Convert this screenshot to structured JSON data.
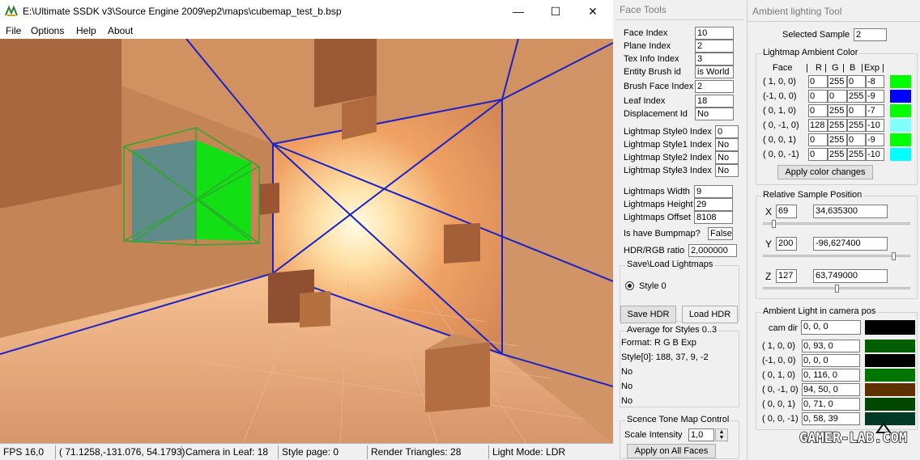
{
  "window": {
    "title": "E:\\Ultimate SSDK v3\\Source Engine 2009\\ep2\\maps\\cubemap_test_b.bsp",
    "minimize_glyph": "—",
    "maximize_glyph": "☐",
    "close_glyph": "✕"
  },
  "menu": [
    "File",
    "Options",
    "Help",
    "About"
  ],
  "status": {
    "fps": "FPS 16,0",
    "camera_pos": "( 71.1258,-131.076, 54.1793)",
    "camera_leaf": "Camera in Leaf: 18",
    "style_page": "Style page: 0",
    "render_triangles": "Render Triangles: 28",
    "light_mode": "Light Mode: LDR"
  },
  "face_tools": {
    "title": "Face Tools",
    "rows": [
      {
        "label": "Face Index",
        "value": "10"
      },
      {
        "label": "Plane Index",
        "value": "2"
      },
      {
        "label": "Tex Info Index",
        "value": "3"
      },
      {
        "label": "Entity Brush id",
        "value": "is World"
      },
      {
        "label": "Brush Face Index",
        "value": "2"
      },
      {
        "label": "Leaf Index",
        "value": "18"
      },
      {
        "label": "Displacement Id",
        "value": "No"
      }
    ],
    "styles": [
      {
        "label": "Lightmap Style0 Index",
        "value": "0"
      },
      {
        "label": "Lightmap Style1 Index",
        "value": "No"
      },
      {
        "label": "Lightmap Style2 Index",
        "value": "No"
      },
      {
        "label": "Lightmap Style3 Index",
        "value": "No"
      }
    ],
    "lightmap": [
      {
        "label": "Lightmaps Width",
        "value": "9"
      },
      {
        "label": "Lightmaps Height",
        "value": "29"
      },
      {
        "label": "Lightmaps Offset",
        "value": "8108"
      }
    ],
    "bumpmap_label": "Is have Bumpmap?",
    "bumpmap_value": "False",
    "hdr_ratio_label": "HDR/RGB ratio",
    "hdr_ratio_value": "2,000000",
    "save_load_title": "Save\\Load Lightmaps",
    "style_radio_label": "Style 0",
    "save_hdr": "Save HDR",
    "load_hdr": "Load HDR",
    "average_title": "Average for Styles 0..3",
    "average_lines": [
      "Format: R G B Exp",
      "Style[0]: 188,  37,  9,  -2",
      "No",
      "No",
      "No"
    ],
    "tonemap_title": "Scence Tone Map Control",
    "scale_label": "Scale Intensity",
    "scale_value": "1,0",
    "apply_all": "Apply on All Faces"
  },
  "ambient_tool": {
    "title": "Ambient lighting Tool",
    "selected_sample_label": "Selected Sample",
    "selected_sample_value": "2",
    "lightmap_color_title": "Lightmap Ambient Color",
    "header": {
      "face": "Face",
      "r": "R",
      "g": "G",
      "b": "B",
      "exp": "Exp"
    },
    "rows": [
      {
        "face": "( 1,  0,  0)",
        "r": "0",
        "g": "255",
        "b": "0",
        "exp": "-8",
        "color": "#00ff00"
      },
      {
        "face": "(-1,  0,  0)",
        "r": "0",
        "g": "0",
        "b": "255",
        "exp": "-9",
        "color": "#0000ff"
      },
      {
        "face": "( 0,  1,  0)",
        "r": "0",
        "g": "255",
        "b": "0",
        "exp": "-7",
        "color": "#00ff00"
      },
      {
        "face": "( 0, -1,  0)",
        "r": "128",
        "g": "255",
        "b": "255",
        "exp": "-10",
        "color": "#80ffff"
      },
      {
        "face": "( 0,  0,  1)",
        "r": "0",
        "g": "255",
        "b": "0",
        "exp": "-9",
        "color": "#00ff00"
      },
      {
        "face": "( 0,  0, -1)",
        "r": "0",
        "g": "255",
        "b": "255",
        "exp": "-10",
        "color": "#00ffff"
      }
    ],
    "apply_color": "Apply color changes",
    "rel_pos_title": "Relative Sample Position",
    "pos": [
      {
        "axis": "X",
        "index": "69",
        "value": "34,635300",
        "slider": 0.06
      },
      {
        "axis": "Y",
        "index": "200",
        "value": "-96,627400",
        "slider": 0.9
      },
      {
        "axis": "Z",
        "index": "127",
        "value": "63,749000",
        "slider": 0.5
      }
    ],
    "camera_title": "Ambient Light in camera pos",
    "cam_dir_label": "cam dir",
    "cam_dir_value": "0, 0, 0",
    "cam_dir_color": "#000000",
    "cam_rows": [
      {
        "face": "( 1,  0,  0)",
        "value": "0, 93, 0",
        "color": "#005d00"
      },
      {
        "face": "(-1,  0,  0)",
        "value": "0, 0, 0",
        "color": "#000000"
      },
      {
        "face": "( 0,  1,  0)",
        "value": "0, 116, 0",
        "color": "#007400"
      },
      {
        "face": "( 0, -1,  0)",
        "value": "94, 50, 0",
        "color": "#5e3200"
      },
      {
        "face": "( 0,  0,  1)",
        "value": "0, 71, 0",
        "color": "#004700"
      },
      {
        "face": "( 0,  0, -1)",
        "value": "0, 58, 39",
        "color": "#003a27"
      }
    ]
  },
  "watermark": "GAMER-LAB.COM"
}
